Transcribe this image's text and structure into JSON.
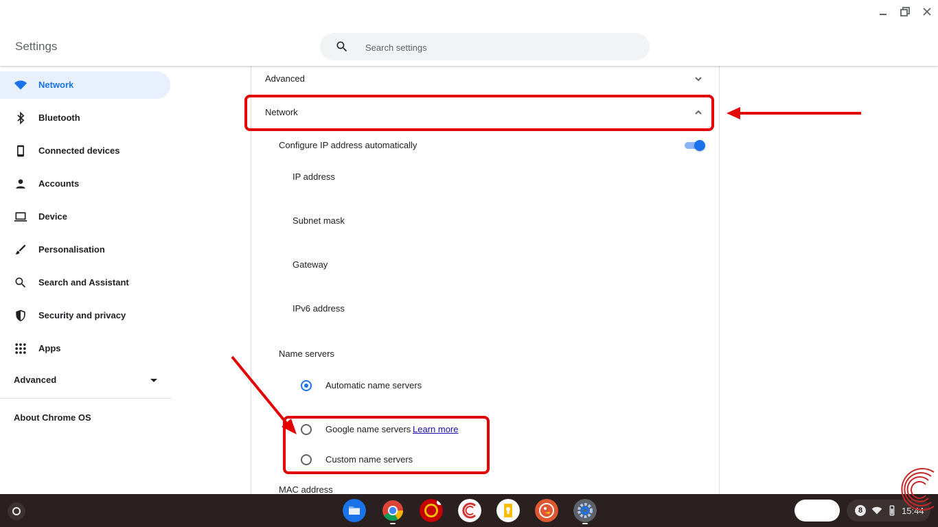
{
  "app": {
    "title": "Settings"
  },
  "search": {
    "placeholder": "Search settings"
  },
  "sidebar": {
    "items": [
      {
        "label": "Network",
        "icon": "wifi-icon"
      },
      {
        "label": "Bluetooth",
        "icon": "bluetooth-icon"
      },
      {
        "label": "Connected devices",
        "icon": "phone-icon"
      },
      {
        "label": "Accounts",
        "icon": "person-icon"
      },
      {
        "label": "Device",
        "icon": "laptop-icon"
      },
      {
        "label": "Personalisation",
        "icon": "brush-icon"
      },
      {
        "label": "Search and Assistant",
        "icon": "search-icon"
      },
      {
        "label": "Security and privacy",
        "icon": "shield-icon"
      },
      {
        "label": "Apps",
        "icon": "apps-grid-icon"
      }
    ],
    "advanced_label": "Advanced",
    "about_label": "About Chrome OS"
  },
  "main": {
    "advanced_label": "Advanced",
    "network_label": "Network",
    "configure_ip_label": "Configure IP address automatically",
    "configure_ip_on": true,
    "fields": [
      "IP address",
      "Subnet mask",
      "Gateway",
      "IPv6 address"
    ],
    "name_servers_label": "Name servers",
    "radios": [
      {
        "label": "Automatic name servers",
        "checked": true
      },
      {
        "label": "Google name servers",
        "checked": false
      },
      {
        "label": "Custom name servers",
        "checked": false
      }
    ],
    "learn_more": "Learn more",
    "mac_label": "MAC address"
  },
  "shelf": {
    "apps": [
      "files-icon",
      "chrome-icon",
      "man-utd-app-icon",
      "c-app-icon",
      "keep-icon",
      "duckduckgo-icon",
      "settings-icon"
    ],
    "notification_count": "8",
    "time": "15:44"
  },
  "colors": {
    "accent": "#1a73e8",
    "annotation": "#e30000",
    "shelf": "#2a2020"
  }
}
